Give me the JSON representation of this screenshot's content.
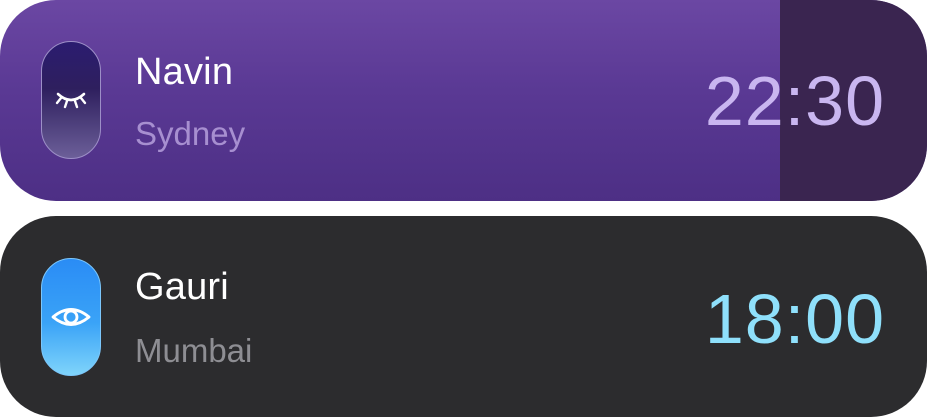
{
  "contacts": [
    {
      "name": "Navin",
      "city": "Sydney",
      "time": "22:30",
      "status_icon": "sleeping-eye-icon",
      "card_color": "#5a3994",
      "time_color": "#c9b6f0"
    },
    {
      "name": "Gauri",
      "city": "Mumbai",
      "time": "18:00",
      "status_icon": "open-eye-icon",
      "card_color": "#2c2c2e",
      "time_color": "#8fe0fb"
    }
  ]
}
